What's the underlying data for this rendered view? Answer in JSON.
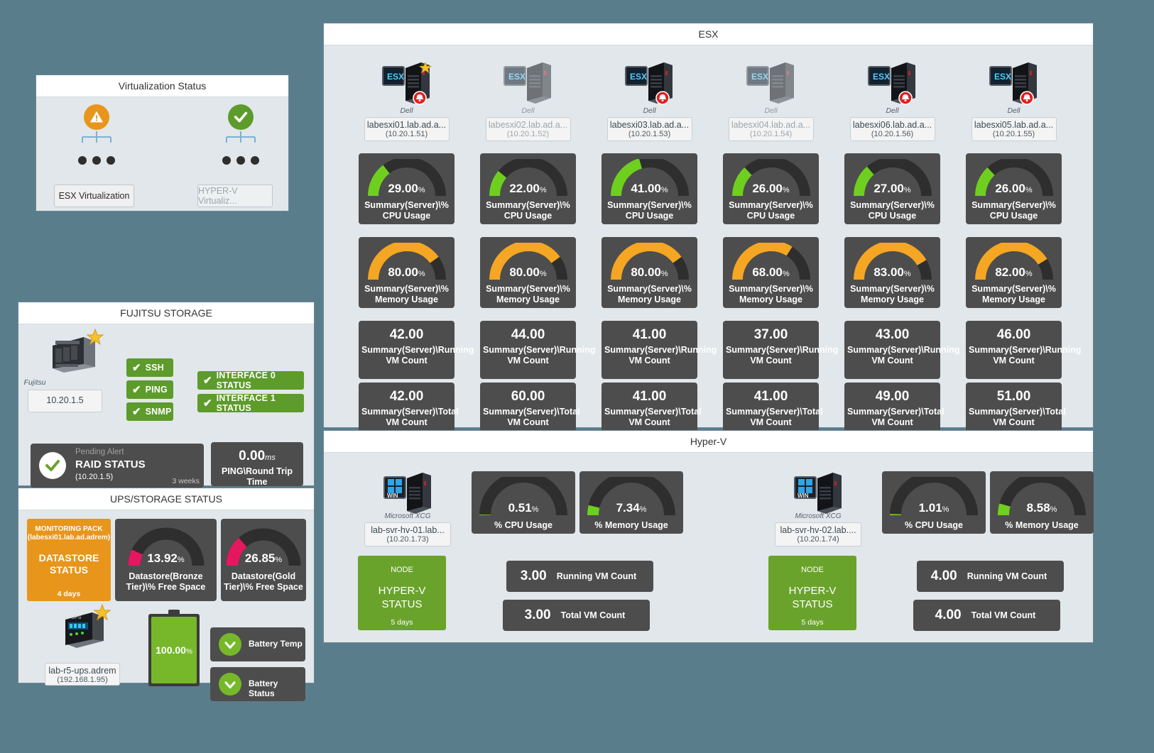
{
  "virtualization_status": {
    "title": "Virtualization Status",
    "nodes": [
      {
        "status": "warning",
        "label": "ESX Virtualization",
        "dimmed": false
      },
      {
        "status": "ok",
        "label": "HYPER-V Virtualiz...",
        "dimmed": true
      }
    ]
  },
  "fujitsu": {
    "title": "FUJITSU STORAGE",
    "device_caption": "Fujitsu",
    "device_ip": "10.20.1.5",
    "checks": [
      {
        "label": "SSH"
      },
      {
        "label": "PING"
      },
      {
        "label": "INTERFACE 0 STATUS"
      },
      {
        "label": "INTERFACE 1 STATUS"
      },
      {
        "label": "SNMP"
      }
    ],
    "raid": {
      "pending": "Pending Alert",
      "title": "RAID STATUS",
      "ip": "(10.20.1.5)",
      "age": "3 weeks"
    },
    "ping_rtt": {
      "value": "0.00",
      "unit": "ms",
      "label": "PING\\Round Trip Time"
    }
  },
  "ups": {
    "title": "UPS/STORAGE STATUS",
    "datastore_alert": {
      "pack": "MONITORING PACK",
      "host": "(labesxi01.lab.ad.adrem)",
      "title": "DATASTORE STATUS",
      "age": "4 days"
    },
    "gauges": [
      {
        "value": "13.92",
        "unit": "%",
        "label": "Datastore(Bronze Tier)\\% Free Space",
        "pct": 13.92,
        "color": "#e5175f"
      },
      {
        "value": "26.85",
        "unit": "%",
        "label": "Datastore(Gold Tier)\\% Free Space",
        "pct": 26.85,
        "color": "#e5175f"
      }
    ],
    "device_caption": "APC",
    "device_name": "lab-r5-ups.adrem",
    "device_ip": "(192.168.1.95)",
    "battery": {
      "value": "100.00",
      "unit": "%"
    },
    "battery_checks": [
      {
        "label": "Battery Temp"
      },
      {
        "label": "Battery Status"
      }
    ]
  },
  "esx": {
    "title": "ESX",
    "vendor": "Dell",
    "cpu_label": "Summary(Server)\\% CPU Usage",
    "mem_label": "Summary(Server)\\% Memory Usage",
    "running_label": "Summary(Server)\\Running VM Count",
    "total_label": "Summary(Server)\\Total VM Count",
    "hosts": [
      {
        "name": "labesxi01.lab.ad.a...",
        "ip": "(10.20.1.51)",
        "alert": true,
        "star": true,
        "dimmed": false,
        "cpu": 29.0,
        "mem": 80.0,
        "running": "42.00",
        "total": "42.00"
      },
      {
        "name": "labesxi02.lab.ad.a...",
        "ip": "(10.20.1.52)",
        "alert": false,
        "star": false,
        "dimmed": true,
        "cpu": 22.0,
        "mem": 80.0,
        "running": "44.00",
        "total": "60.00"
      },
      {
        "name": "labesxi03.lab.ad.a...",
        "ip": "(10.20.1.53)",
        "alert": true,
        "star": false,
        "dimmed": false,
        "cpu": 41.0,
        "mem": 80.0,
        "running": "41.00",
        "total": "41.00"
      },
      {
        "name": "labesxi04.lab.ad.a...",
        "ip": "(10.20.1.54)",
        "alert": false,
        "star": false,
        "dimmed": true,
        "cpu": 26.0,
        "mem": 68.0,
        "running": "37.00",
        "total": "41.00"
      },
      {
        "name": "labesxi06.lab.ad.a...",
        "ip": "(10.20.1.56)",
        "alert": true,
        "star": false,
        "dimmed": false,
        "cpu": 27.0,
        "mem": 83.0,
        "running": "43.00",
        "total": "49.00"
      },
      {
        "name": "labesxi05.lab.ad.a...",
        "ip": "(10.20.1.55)",
        "alert": true,
        "star": false,
        "dimmed": false,
        "cpu": 26.0,
        "mem": 82.0,
        "running": "46.00",
        "total": "51.00"
      }
    ]
  },
  "hyperv": {
    "title": "Hyper-V",
    "vendor": "Microsoft XCG",
    "cpu_label": "% CPU Usage",
    "mem_label": "% Memory Usage",
    "running_label": "Running VM Count",
    "total_label": "Total VM Count",
    "node_kicker": "NODE",
    "node_title": "HYPER-V STATUS",
    "nodes": [
      {
        "name": "lab-svr-hv-01.lab...",
        "ip": "(10.20.1.73)",
        "cpu": 0.51,
        "mem": 7.34,
        "running": "3.00",
        "total": "3.00",
        "age": "5 days"
      },
      {
        "name": "lab-svr-hv-02.lab....",
        "ip": "(10.20.1.74)",
        "cpu": 1.01,
        "mem": 8.58,
        "running": "4.00",
        "total": "4.00",
        "age": "5 days"
      }
    ]
  },
  "colors": {
    "cpu_green": "#6fcf1f",
    "mem_orange": "#f5a623",
    "track": "#2e2e2e",
    "tile": "#4d4d4d",
    "panel_bg": "#e1e7ea",
    "page_bg": "#5a7d8c",
    "ok_green": "#5d9b2a",
    "warn_orange": "#e8951c",
    "pink": "#e5175f"
  }
}
